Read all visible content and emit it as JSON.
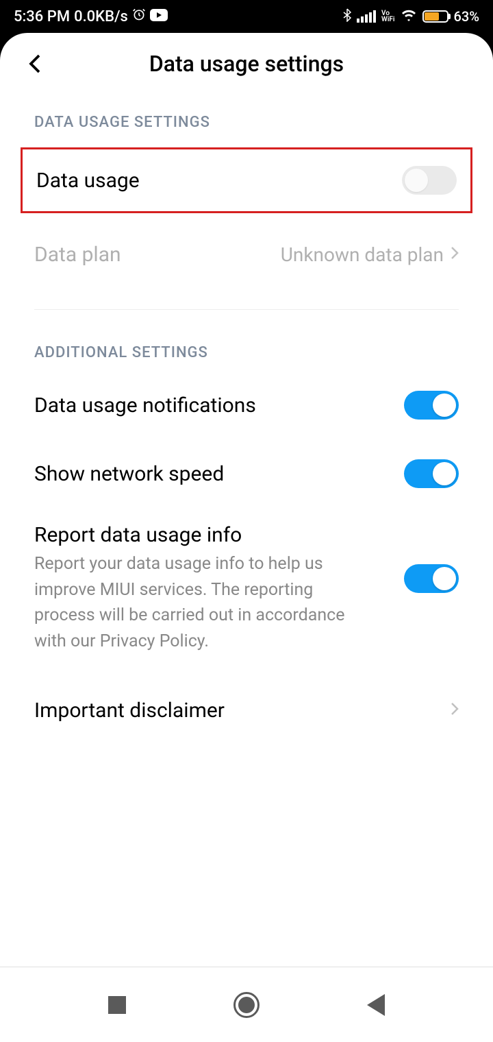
{
  "statusbar": {
    "time": "5:36 PM",
    "netspeed": "0.0KB/s",
    "battery": "63%"
  },
  "header": {
    "title": "Data usage settings"
  },
  "sections": {
    "main": {
      "header": "DATA USAGE SETTINGS",
      "items": {
        "data_usage": {
          "label": "Data usage",
          "toggle": false
        },
        "data_plan": {
          "label": "Data plan",
          "value": "Unknown data plan"
        }
      }
    },
    "additional": {
      "header": "ADDITIONAL SETTINGS",
      "items": {
        "notifications": {
          "label": "Data usage notifications",
          "toggle": true
        },
        "network_speed": {
          "label": "Show network speed",
          "toggle": true
        },
        "report": {
          "label": "Report data usage info",
          "description": "Report your data usage info to help us improve MIUI services. The reporting process will be carried out in accordance with our Privacy Policy.",
          "toggle": true
        },
        "disclaimer": {
          "label": "Important disclaimer"
        }
      }
    }
  }
}
